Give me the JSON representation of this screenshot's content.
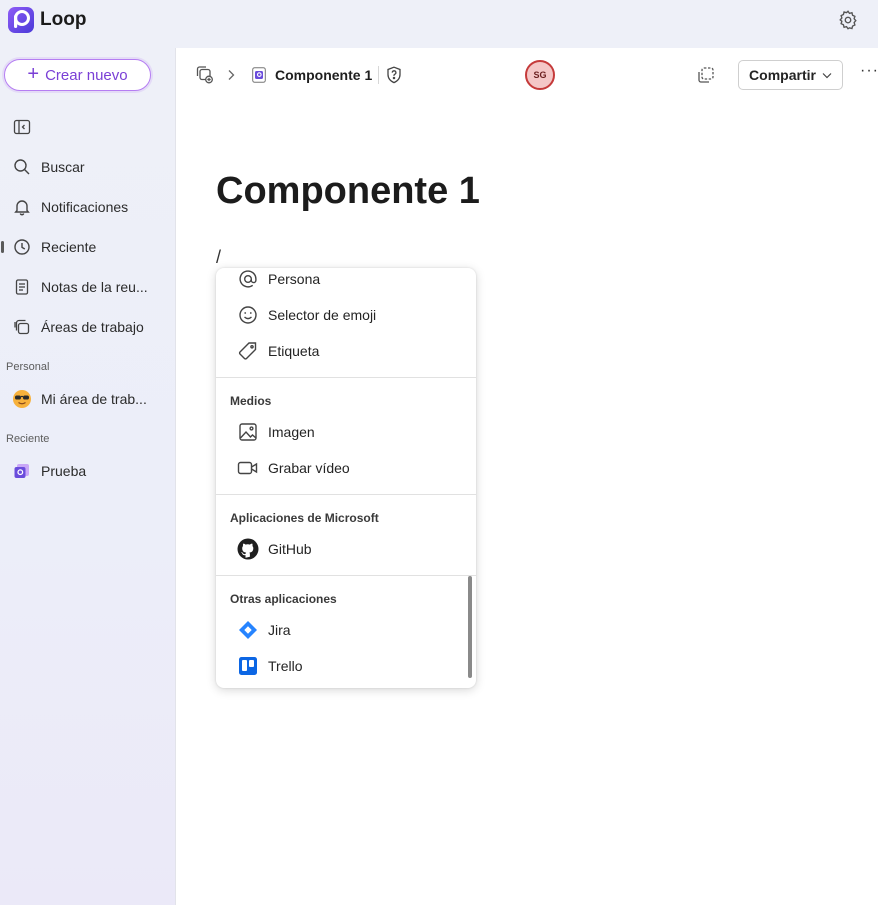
{
  "app": {
    "name": "Loop"
  },
  "sidebar": {
    "create_label": "Crear nuevo",
    "nav": [
      {
        "label": "Buscar",
        "icon": "search-icon"
      },
      {
        "label": "Notificaciones",
        "icon": "bell-icon"
      },
      {
        "label": "Reciente",
        "icon": "clock-icon"
      },
      {
        "label": "Notas de la reu...",
        "icon": "notes-icon"
      },
      {
        "label": "Áreas de trabajo",
        "icon": "workspaces-icon"
      }
    ],
    "personal_heading": "Personal",
    "personal_items": [
      {
        "label": "Mi área de trab...",
        "icon": "sunglasses-emoji-icon"
      }
    ],
    "recent_heading": "Reciente",
    "recent_items": [
      {
        "label": "Prueba",
        "icon": "loop-page-icon"
      }
    ]
  },
  "toolbar": {
    "page_name": "Componente 1",
    "avatar_initials": "SG",
    "share_label": "Compartir",
    "more_label": "···"
  },
  "document": {
    "title": "Componente 1",
    "slash": "/"
  },
  "menu": {
    "items_top": [
      {
        "label": "Persona",
        "icon": "at-icon"
      },
      {
        "label": "Selector de emoji",
        "icon": "smiley-icon"
      },
      {
        "label": "Etiqueta",
        "icon": "tag-icon"
      }
    ],
    "media_heading": "Medios",
    "media_items": [
      {
        "label": "Imagen",
        "icon": "image-icon"
      },
      {
        "label": "Grabar vídeo",
        "icon": "video-icon"
      }
    ],
    "microsoft_heading": "Aplicaciones de Microsoft",
    "microsoft_items": [
      {
        "label": "GitHub",
        "icon": "github-icon"
      }
    ],
    "other_heading": "Otras aplicaciones",
    "other_items": [
      {
        "label": "Jira",
        "icon": "jira-icon"
      },
      {
        "label": "Trello",
        "icon": "trello-icon"
      }
    ]
  },
  "colors": {
    "accent": "#7a3fd6",
    "sidebar_bg": "#eef0f8",
    "avatar_ring": "#c53a3a",
    "jira_blue": "#2684ff",
    "trello_blue": "#0c66e4"
  }
}
